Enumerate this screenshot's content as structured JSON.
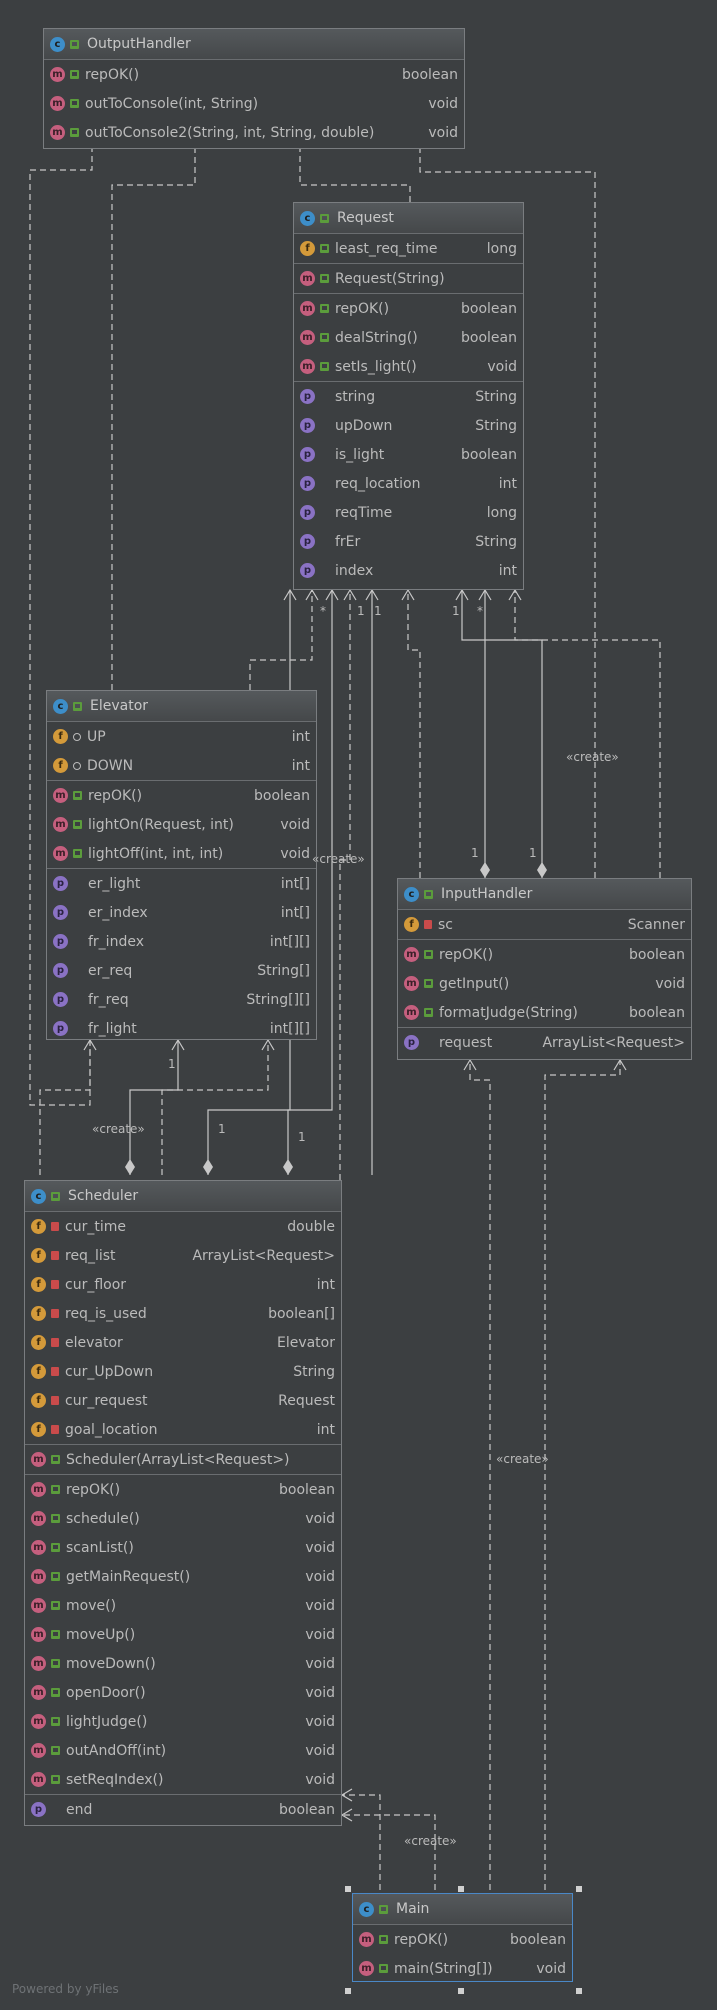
{
  "classes": {
    "output_handler": {
      "name": "OutputHandler",
      "members": [
        {
          "icon": "m",
          "name": "repOK()",
          "type": "boolean"
        },
        {
          "icon": "m",
          "name": "outToConsole(int, String)",
          "type": "void"
        },
        {
          "icon": "m",
          "name": "outToConsole2(String, int, String, double)",
          "type": "void"
        }
      ]
    },
    "request": {
      "name": "Request",
      "fields": [
        {
          "icon": "f",
          "name": "least_req_time",
          "type": "long"
        }
      ],
      "constructors": [
        {
          "icon": "m",
          "name": "Request(String)",
          "type": ""
        }
      ],
      "methods": [
        {
          "icon": "m",
          "name": "repOK()",
          "type": "boolean"
        },
        {
          "icon": "m",
          "name": "dealString()",
          "type": "boolean"
        },
        {
          "icon": "m",
          "name": "setIs_light()",
          "type": "void"
        }
      ],
      "properties": [
        {
          "icon": "p",
          "name": "string",
          "type": "String"
        },
        {
          "icon": "p",
          "name": "upDown",
          "type": "String"
        },
        {
          "icon": "p",
          "name": "is_light",
          "type": "boolean"
        },
        {
          "icon": "p",
          "name": "req_location",
          "type": "int"
        },
        {
          "icon": "p",
          "name": "reqTime",
          "type": "long"
        },
        {
          "icon": "p",
          "name": "frEr",
          "type": "String"
        },
        {
          "icon": "p",
          "name": "index",
          "type": "int"
        }
      ]
    },
    "elevator": {
      "name": "Elevator",
      "fields": [
        {
          "icon": "f",
          "name": "UP",
          "type": "int"
        },
        {
          "icon": "f",
          "name": "DOWN",
          "type": "int"
        }
      ],
      "methods": [
        {
          "icon": "m",
          "name": "repOK()",
          "type": "boolean"
        },
        {
          "icon": "m",
          "name": "lightOn(Request, int)",
          "type": "void"
        },
        {
          "icon": "m",
          "name": "lightOff(int, int, int)",
          "type": "void"
        }
      ],
      "properties": [
        {
          "icon": "p",
          "name": "er_light",
          "type": "int[]"
        },
        {
          "icon": "p",
          "name": "er_index",
          "type": "int[]"
        },
        {
          "icon": "p",
          "name": "fr_index",
          "type": "int[][]"
        },
        {
          "icon": "p",
          "name": "er_req",
          "type": "String[]"
        },
        {
          "icon": "p",
          "name": "fr_req",
          "type": "String[][]"
        },
        {
          "icon": "p",
          "name": "fr_light",
          "type": "int[][]"
        }
      ]
    },
    "input_handler": {
      "name": "InputHandler",
      "fields": [
        {
          "icon": "f",
          "name": "sc",
          "type": "Scanner"
        }
      ],
      "methods": [
        {
          "icon": "m",
          "name": "repOK()",
          "type": "boolean"
        },
        {
          "icon": "m",
          "name": "getInput()",
          "type": "void"
        },
        {
          "icon": "m",
          "name": "formatJudge(String)",
          "type": "boolean"
        }
      ],
      "properties": [
        {
          "icon": "p",
          "name": "request",
          "type": "ArrayList<Request>"
        }
      ]
    },
    "scheduler": {
      "name": "Scheduler",
      "fields": [
        {
          "icon": "f",
          "name": "cur_time",
          "type": "double"
        },
        {
          "icon": "f",
          "name": "req_list",
          "type": "ArrayList<Request>"
        },
        {
          "icon": "f",
          "name": "cur_floor",
          "type": "int"
        },
        {
          "icon": "f",
          "name": "req_is_used",
          "type": "boolean[]"
        },
        {
          "icon": "f",
          "name": "elevator",
          "type": "Elevator"
        },
        {
          "icon": "f",
          "name": "cur_UpDown",
          "type": "String"
        },
        {
          "icon": "f",
          "name": "cur_request",
          "type": "Request"
        },
        {
          "icon": "f",
          "name": "goal_location",
          "type": "int"
        }
      ],
      "constructors": [
        {
          "icon": "m",
          "name": "Scheduler(ArrayList<Request>)",
          "type": ""
        }
      ],
      "methods": [
        {
          "icon": "m",
          "name": "repOK()",
          "type": "boolean"
        },
        {
          "icon": "m",
          "name": "schedule()",
          "type": "void"
        },
        {
          "icon": "m",
          "name": "scanList()",
          "type": "void"
        },
        {
          "icon": "m",
          "name": "getMainRequest()",
          "type": "void"
        },
        {
          "icon": "m",
          "name": "move()",
          "type": "void"
        },
        {
          "icon": "m",
          "name": "moveUp()",
          "type": "void"
        },
        {
          "icon": "m",
          "name": "moveDown()",
          "type": "void"
        },
        {
          "icon": "m",
          "name": "openDoor()",
          "type": "void"
        },
        {
          "icon": "m",
          "name": "lightJudge()",
          "type": "void"
        },
        {
          "icon": "m",
          "name": "outAndOff(int)",
          "type": "void"
        },
        {
          "icon": "m",
          "name": "setReqIndex()",
          "type": "void"
        }
      ],
      "properties": [
        {
          "icon": "p",
          "name": "end",
          "type": "boolean"
        }
      ]
    },
    "main": {
      "name": "Main",
      "methods": [
        {
          "icon": "m",
          "name": "repOK()",
          "type": "boolean"
        },
        {
          "icon": "m",
          "name": "main(String[])",
          "type": "void"
        }
      ]
    }
  },
  "edge_labels": {
    "create": "«create»",
    "one": "1",
    "many": "*"
  },
  "watermark": "Powered by yFiles"
}
